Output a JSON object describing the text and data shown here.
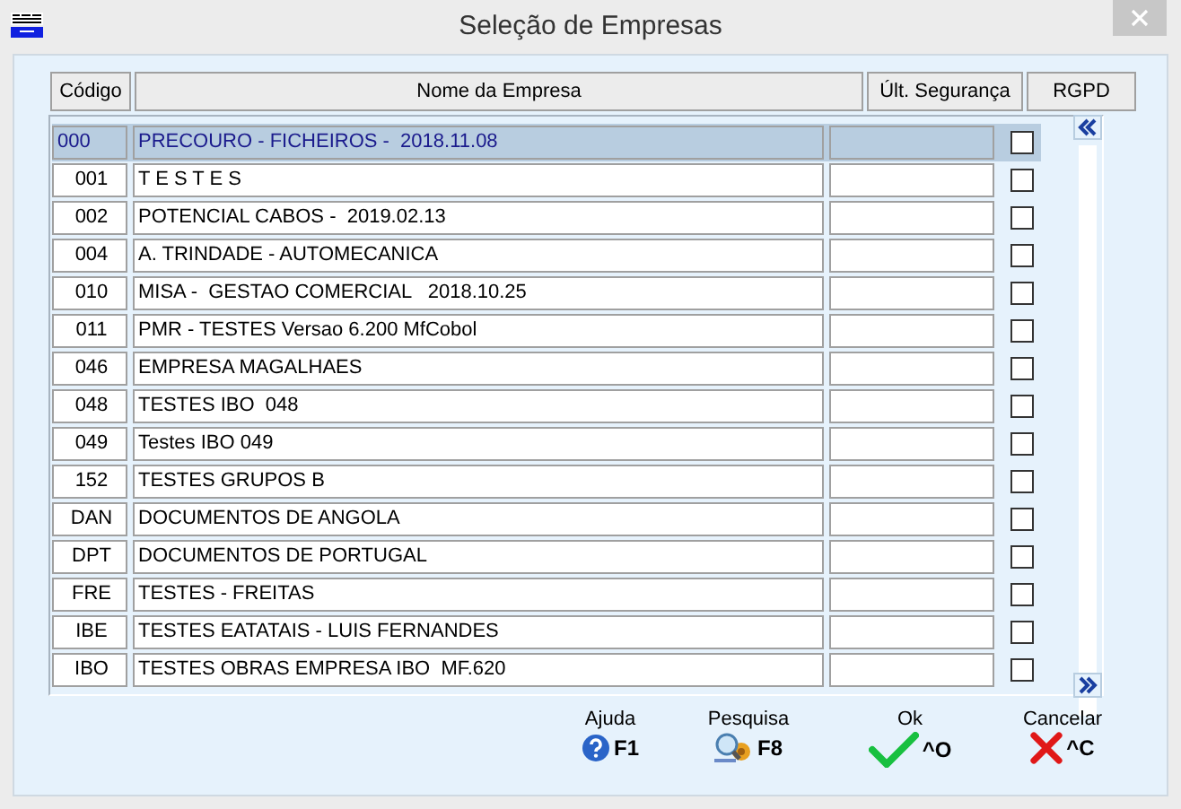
{
  "window": {
    "title": "Seleção de Empresas"
  },
  "columns": [
    "Código",
    "Nome da Empresa",
    "Últ. Segurança",
    "RGPD"
  ],
  "rows": [
    {
      "code": "000",
      "name": "PRECOURO - FICHEIROS -  2018.11.08",
      "rgpd": false,
      "selected": true
    },
    {
      "code": "001",
      "name": "T E S T E S",
      "rgpd": false,
      "selected": false
    },
    {
      "code": "002",
      "name": "POTENCIAL CABOS -  2019.02.13",
      "rgpd": false,
      "selected": false
    },
    {
      "code": "004",
      "name": "A. TRINDADE - AUTOMECANICA",
      "rgpd": false,
      "selected": false
    },
    {
      "code": "010",
      "name": "MISA -  GESTAO COMERCIAL   2018.10.25",
      "rgpd": false,
      "selected": false
    },
    {
      "code": "011",
      "name": "PMR - TESTES Versao 6.200 MfCobol",
      "rgpd": false,
      "selected": false
    },
    {
      "code": "046",
      "name": "EMPRESA MAGALHAES",
      "rgpd": false,
      "selected": false
    },
    {
      "code": "048",
      "name": "TESTES IBO  048",
      "rgpd": false,
      "selected": false
    },
    {
      "code": "049",
      "name": "Testes IBO 049",
      "rgpd": false,
      "selected": false
    },
    {
      "code": "152",
      "name": "TESTES GRUPOS B",
      "rgpd": false,
      "selected": false
    },
    {
      "code": "DAN",
      "name": "DOCUMENTOS DE ANGOLA",
      "rgpd": false,
      "selected": false
    },
    {
      "code": "DPT",
      "name": "DOCUMENTOS DE PORTUGAL",
      "rgpd": false,
      "selected": false
    },
    {
      "code": "FRE",
      "name": "TESTES - FREITAS",
      "rgpd": false,
      "selected": false
    },
    {
      "code": "IBE",
      "name": "TESTES EATATAIS - LUIS FERNANDES",
      "rgpd": false,
      "selected": false
    },
    {
      "code": "IBO",
      "name": "TESTES OBRAS EMPRESA IBO  MF.620",
      "rgpd": false,
      "selected": false
    }
  ],
  "buttons": [
    {
      "kind": "help",
      "label": "Ajuda",
      "key": "F1"
    },
    {
      "kind": "search",
      "label": "Pesquisa",
      "key": "F8"
    },
    {
      "kind": "ok",
      "label": "Ok",
      "key": "^O"
    },
    {
      "kind": "cancel",
      "label": "Cancelar",
      "key": "^C"
    }
  ]
}
